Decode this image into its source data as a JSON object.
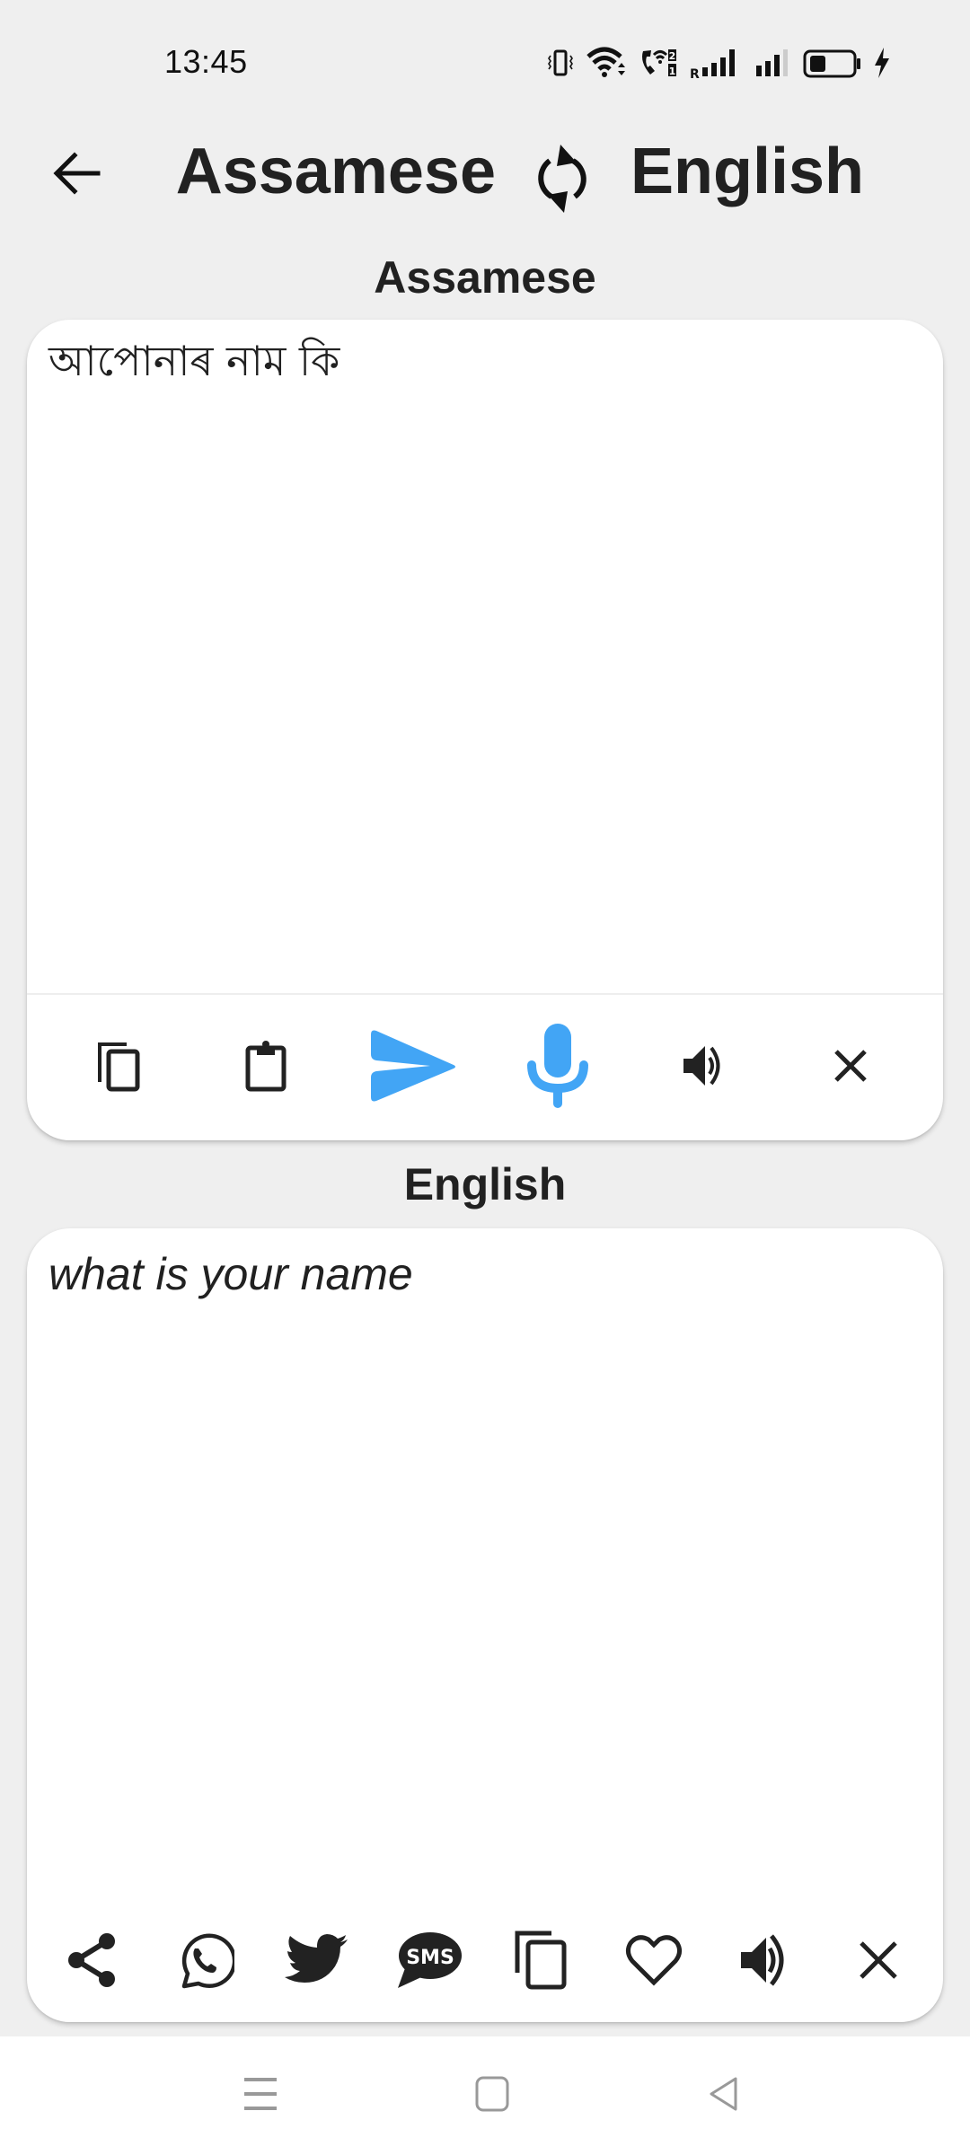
{
  "status_bar": {
    "time": "13:45",
    "icons": [
      "vibrate-icon",
      "wifi-icon",
      "wifi-calling-icon",
      "dual-sim-icon",
      "signal-roaming-icon",
      "signal-icon",
      "battery-icon",
      "charging-icon"
    ],
    "battery_level": 0.3
  },
  "header": {
    "back_icon": "arrow-left-icon",
    "source_language": "Assamese",
    "swap_icon": "swap-sync-icon",
    "target_language": "English"
  },
  "source": {
    "label": "Assamese",
    "text": "আপোনাৰ নাম কি",
    "toolbar": [
      {
        "name": "copy",
        "icon": "copy-icon"
      },
      {
        "name": "paste",
        "icon": "clipboard-icon"
      },
      {
        "name": "translate",
        "icon": "send-icon"
      },
      {
        "name": "voice-input",
        "icon": "microphone-icon"
      },
      {
        "name": "speak",
        "icon": "speaker-icon"
      },
      {
        "name": "clear",
        "icon": "close-icon"
      }
    ]
  },
  "target": {
    "label": "English",
    "text": "what is your name",
    "toolbar": [
      {
        "name": "share",
        "icon": "share-icon"
      },
      {
        "name": "whatsapp",
        "icon": "whatsapp-icon"
      },
      {
        "name": "twitter",
        "icon": "twitter-icon"
      },
      {
        "name": "sms",
        "icon": "sms-icon",
        "glyph_text": "SMS"
      },
      {
        "name": "copy",
        "icon": "copy-icon"
      },
      {
        "name": "favorite",
        "icon": "heart-icon"
      },
      {
        "name": "speak",
        "icon": "speaker-icon"
      },
      {
        "name": "clear",
        "icon": "close-icon"
      }
    ]
  },
  "nav_bar": {
    "items": [
      "recent-apps-icon",
      "home-icon",
      "back-icon"
    ]
  },
  "colors": {
    "accent": "#42a5f5",
    "background": "#efefef",
    "card": "#ffffff",
    "text": "#212121",
    "nav_icon": "#999999"
  }
}
